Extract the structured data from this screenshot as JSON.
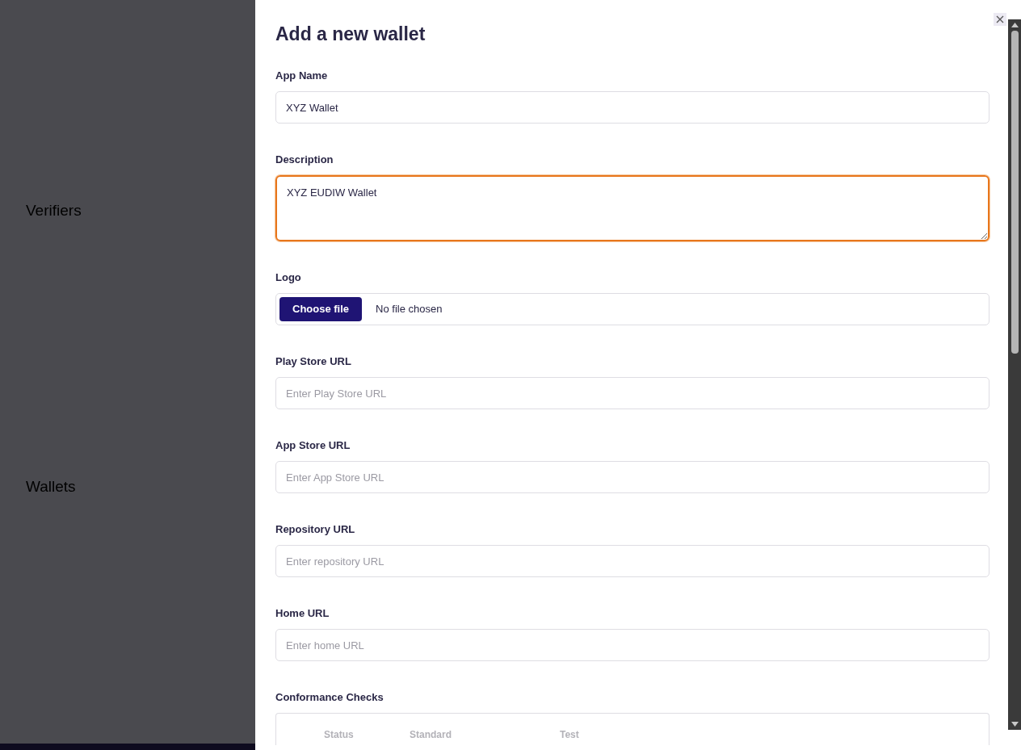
{
  "background": {
    "sections": [
      "Verifiers",
      "Wallets"
    ]
  },
  "dialog": {
    "title": "Add a new wallet",
    "fields": [
      {
        "kind": "text",
        "label": "App Name",
        "value": "XYZ Wallet",
        "focused": false
      },
      {
        "kind": "textarea",
        "label": "Description",
        "value": "XYZ EUDIW Wallet",
        "focused": true
      },
      {
        "kind": "file",
        "label": "Logo",
        "button": "Choose file",
        "file_status": "No file chosen",
        "focused": false
      },
      {
        "kind": "text",
        "label": "Play Store URL",
        "placeholder": "Enter Play Store URL",
        "focused": false
      },
      {
        "kind": "text",
        "label": "App Store URL",
        "placeholder": "Enter App Store URL",
        "focused": false
      },
      {
        "kind": "text",
        "label": "Repository URL",
        "placeholder": "Enter repository URL",
        "focused": false
      },
      {
        "kind": "text",
        "label": "Home URL",
        "placeholder": "Enter home URL",
        "focused": false
      }
    ],
    "conformance": {
      "label": "Conformance Checks",
      "columns": [
        "Status",
        "Standard",
        "Test"
      ]
    }
  }
}
